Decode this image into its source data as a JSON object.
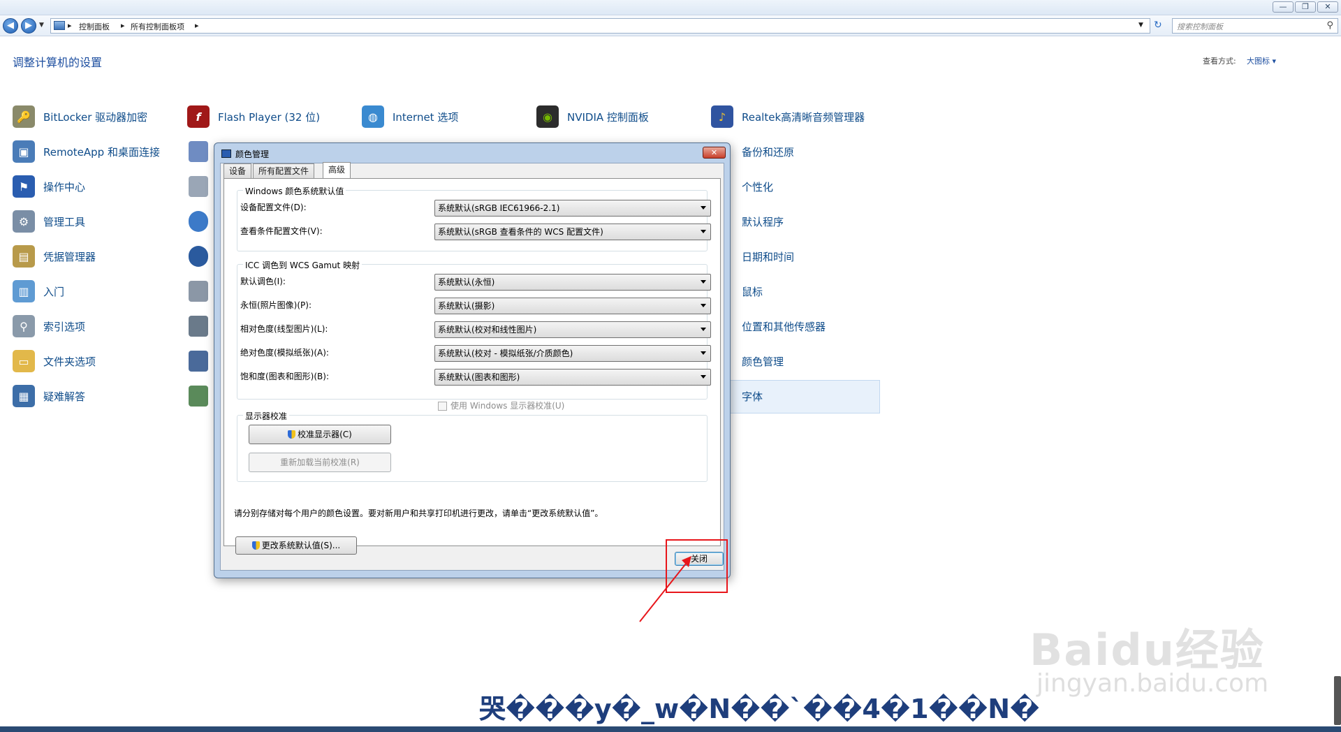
{
  "window": {
    "minimize": "—",
    "maximize": "❐",
    "close": "✕"
  },
  "address": {
    "breadcrumb": [
      "控制面板",
      "所有控制面板项"
    ],
    "search_placeholder": "搜索控制面板"
  },
  "page": {
    "title": "调整计算机的设置",
    "view_by_label": "查看方式:",
    "view_mode": "大图标 ▾"
  },
  "cp_items": {
    "col1": [
      "BitLocker 驱动器加密",
      "RemoteApp 和桌面连接",
      "操作中心",
      "管理工具",
      "凭据管理器",
      "入门",
      "索引选项",
      "文件夹选项",
      "疑难解答"
    ],
    "top_row": [
      "Flash Player (32 位)",
      "Internet 选项",
      "NVIDIA 控制面板",
      "Realtek高清晰音频管理器"
    ],
    "col5": [
      "备份和还原",
      "个性化",
      "默认程序",
      "日期和时间",
      "鼠标",
      "位置和其他传感器",
      "颜色管理",
      "字体"
    ]
  },
  "dialog": {
    "title": "颜色管理",
    "close_glyph": "✕",
    "tabs": [
      "设备",
      "所有配置文件",
      "高级"
    ],
    "group1": {
      "title": "Windows 颜色系统默认值",
      "rows": [
        {
          "label": "设备配置文件(D):",
          "value": "系统默认(sRGB IEC61966-2.1)"
        },
        {
          "label": "查看条件配置文件(V):",
          "value": "系统默认(sRGB 查看条件的 WCS 配置文件)"
        }
      ]
    },
    "group2": {
      "title": "ICC 调色到 WCS Gamut 映射",
      "rows": [
        {
          "label": "默认调色(I):",
          "value": "系统默认(永恒)"
        },
        {
          "label": "永恒(照片图像)(P):",
          "value": "系统默认(摄影)"
        },
        {
          "label": "相对色度(线型图片)(L):",
          "value": "系统默认(校对和线性图片)"
        },
        {
          "label": "绝对色度(模拟纸张)(A):",
          "value": "系统默认(校对 - 模拟纸张/介质颜色)"
        },
        {
          "label": "饱和度(图表和图形)(B):",
          "value": "系统默认(图表和图形)"
        }
      ]
    },
    "group3": {
      "title": "显示器校准",
      "calibrate_button": "校准显示器(C)",
      "reload_button": "重新加载当前校准(R)",
      "checkbox_label": "使用 Windows 显示器校准(U)"
    },
    "note": "请分别存储对每个用户的颜色设置。要对新用户和共享打印机进行更改，请单击“更改系统默认值”。",
    "change_defaults_button": "更改系统默认值(S)...",
    "close_button": "关闭"
  },
  "overlay": {
    "watermark": "Baidu经验",
    "watermark_sub": "jingyan.baidu.com",
    "garbled_caption": "哭���y�_w�N��`��4�1��N�"
  }
}
